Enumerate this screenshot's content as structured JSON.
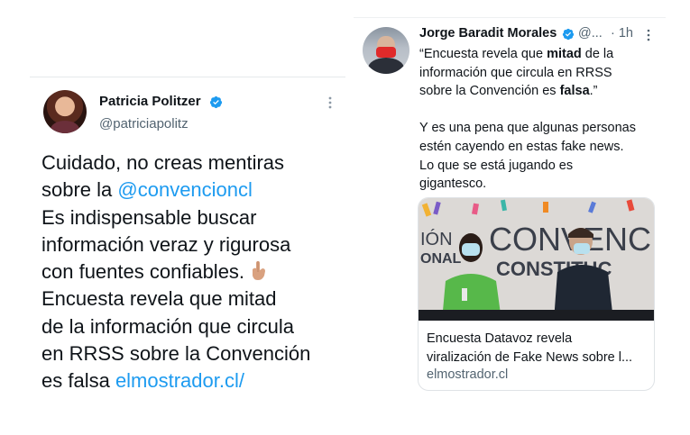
{
  "left_tweet": {
    "author_name": "Patricia Politzer",
    "handle": "@patriciapolitz",
    "lines": [
      [
        {
          "t": "Cuidado, no creas mentiras",
          "link": false
        }
      ],
      [
        {
          "t": "sobre la ",
          "link": false
        },
        {
          "t": "@convencioncl",
          "link": true
        }
      ],
      [
        {
          "t": "Es indispensable buscar",
          "link": false
        }
      ],
      [
        {
          "t": "información veraz y rigurosa",
          "link": false
        }
      ],
      [
        {
          "t": "con fuentes confiables.",
          "link": false
        }
      ],
      [
        {
          "t": "Encuesta revela que mitad",
          "link": false
        }
      ],
      [
        {
          "t": "de la información que circula",
          "link": false
        }
      ],
      [
        {
          "t": "en RRSS sobre la Convención",
          "link": false
        }
      ],
      [
        {
          "t": "es falsa ",
          "link": false
        },
        {
          "t": "elmostrador.cl/",
          "link": true
        }
      ]
    ],
    "emoji_icon": "backhand-index-pointing-down-emoji",
    "more_icon": "more-vertical-icon",
    "verified_icon": "verified-badge-icon"
  },
  "right_tweet": {
    "author_name": "Jorge Baradit Morales",
    "handle": "@...",
    "time": "· 1h",
    "lines": [
      [
        {
          "t": "“Encuesta revela que ",
          "b": false
        },
        {
          "t": "mitad",
          "b": true
        },
        {
          "t": " de la",
          "b": false
        }
      ],
      [
        {
          "t": "información que circula en RRSS",
          "b": false
        }
      ],
      [
        {
          "t": "sobre la Convención es ",
          "b": false
        },
        {
          "t": "falsa",
          "b": true
        },
        {
          "t": ".”",
          "b": false
        }
      ],
      [],
      [
        {
          "t": "Y es una pena que algunas personas",
          "b": false
        }
      ],
      [
        {
          "t": "estén cayendo en estas fake news.",
          "b": false
        }
      ],
      [
        {
          "t": "Lo que se está jugando es",
          "b": false
        }
      ],
      [
        {
          "t": "gigantesco.",
          "b": false
        }
      ]
    ],
    "card": {
      "image_text_left": "IÓN",
      "image_text_left2": "ONAL",
      "image_text_main": "CONVENCIÓ",
      "image_text_main2": "CONSTITUC",
      "title_lines": [
        "Encuesta Datavoz revela",
        "viralización de Fake News sobre l..."
      ],
      "domain": "elmostrador.cl"
    },
    "more_icon": "more-vertical-icon",
    "verified_icon": "verified-badge-icon"
  },
  "colors": {
    "link": "#1d9bf0",
    "text": "#0f1419",
    "secondary": "#536471",
    "verified": "#1d9bf0"
  }
}
